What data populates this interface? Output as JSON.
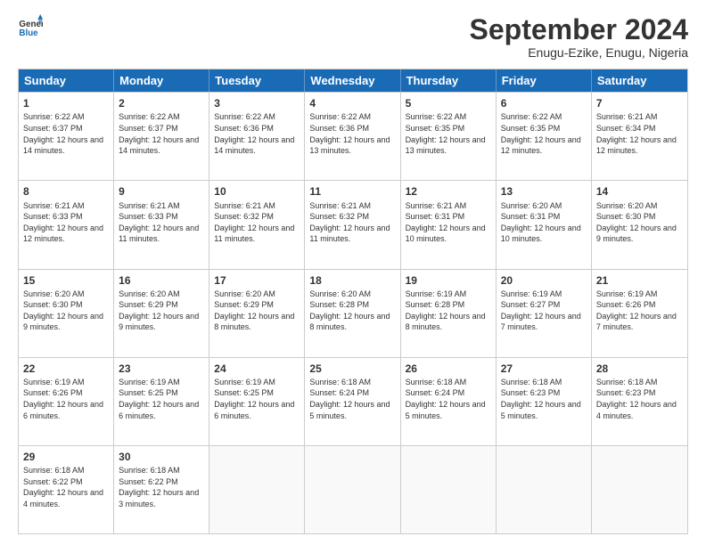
{
  "header": {
    "logo_general": "General",
    "logo_blue": "Blue",
    "month_title": "September 2024",
    "location": "Enugu-Ezike, Enugu, Nigeria"
  },
  "weekdays": [
    "Sunday",
    "Monday",
    "Tuesday",
    "Wednesday",
    "Thursday",
    "Friday",
    "Saturday"
  ],
  "rows": [
    [
      {
        "day": "",
        "empty": true
      },
      {
        "day": "",
        "empty": true
      },
      {
        "day": "",
        "empty": true
      },
      {
        "day": "",
        "empty": true
      },
      {
        "day": "",
        "empty": true
      },
      {
        "day": "",
        "empty": true
      },
      {
        "day": "",
        "empty": true
      }
    ],
    [
      {
        "day": "1",
        "sunrise": "6:22 AM",
        "sunset": "6:37 PM",
        "daylight": "12 hours and 14 minutes."
      },
      {
        "day": "2",
        "sunrise": "6:22 AM",
        "sunset": "6:37 PM",
        "daylight": "12 hours and 14 minutes."
      },
      {
        "day": "3",
        "sunrise": "6:22 AM",
        "sunset": "6:36 PM",
        "daylight": "12 hours and 14 minutes."
      },
      {
        "day": "4",
        "sunrise": "6:22 AM",
        "sunset": "6:36 PM",
        "daylight": "12 hours and 13 minutes."
      },
      {
        "day": "5",
        "sunrise": "6:22 AM",
        "sunset": "6:35 PM",
        "daylight": "12 hours and 13 minutes."
      },
      {
        "day": "6",
        "sunrise": "6:22 AM",
        "sunset": "6:35 PM",
        "daylight": "12 hours and 12 minutes."
      },
      {
        "day": "7",
        "sunrise": "6:21 AM",
        "sunset": "6:34 PM",
        "daylight": "12 hours and 12 minutes."
      }
    ],
    [
      {
        "day": "8",
        "sunrise": "6:21 AM",
        "sunset": "6:33 PM",
        "daylight": "12 hours and 12 minutes."
      },
      {
        "day": "9",
        "sunrise": "6:21 AM",
        "sunset": "6:33 PM",
        "daylight": "12 hours and 11 minutes."
      },
      {
        "day": "10",
        "sunrise": "6:21 AM",
        "sunset": "6:32 PM",
        "daylight": "12 hours and 11 minutes."
      },
      {
        "day": "11",
        "sunrise": "6:21 AM",
        "sunset": "6:32 PM",
        "daylight": "12 hours and 11 minutes."
      },
      {
        "day": "12",
        "sunrise": "6:21 AM",
        "sunset": "6:31 PM",
        "daylight": "12 hours and 10 minutes."
      },
      {
        "day": "13",
        "sunrise": "6:20 AM",
        "sunset": "6:31 PM",
        "daylight": "12 hours and 10 minutes."
      },
      {
        "day": "14",
        "sunrise": "6:20 AM",
        "sunset": "6:30 PM",
        "daylight": "12 hours and 9 minutes."
      }
    ],
    [
      {
        "day": "15",
        "sunrise": "6:20 AM",
        "sunset": "6:30 PM",
        "daylight": "12 hours and 9 minutes."
      },
      {
        "day": "16",
        "sunrise": "6:20 AM",
        "sunset": "6:29 PM",
        "daylight": "12 hours and 9 minutes."
      },
      {
        "day": "17",
        "sunrise": "6:20 AM",
        "sunset": "6:29 PM",
        "daylight": "12 hours and 8 minutes."
      },
      {
        "day": "18",
        "sunrise": "6:20 AM",
        "sunset": "6:28 PM",
        "daylight": "12 hours and 8 minutes."
      },
      {
        "day": "19",
        "sunrise": "6:19 AM",
        "sunset": "6:28 PM",
        "daylight": "12 hours and 8 minutes."
      },
      {
        "day": "20",
        "sunrise": "6:19 AM",
        "sunset": "6:27 PM",
        "daylight": "12 hours and 7 minutes."
      },
      {
        "day": "21",
        "sunrise": "6:19 AM",
        "sunset": "6:26 PM",
        "daylight": "12 hours and 7 minutes."
      }
    ],
    [
      {
        "day": "22",
        "sunrise": "6:19 AM",
        "sunset": "6:26 PM",
        "daylight": "12 hours and 6 minutes."
      },
      {
        "day": "23",
        "sunrise": "6:19 AM",
        "sunset": "6:25 PM",
        "daylight": "12 hours and 6 minutes."
      },
      {
        "day": "24",
        "sunrise": "6:19 AM",
        "sunset": "6:25 PM",
        "daylight": "12 hours and 6 minutes."
      },
      {
        "day": "25",
        "sunrise": "6:18 AM",
        "sunset": "6:24 PM",
        "daylight": "12 hours and 5 minutes."
      },
      {
        "day": "26",
        "sunrise": "6:18 AM",
        "sunset": "6:24 PM",
        "daylight": "12 hours and 5 minutes."
      },
      {
        "day": "27",
        "sunrise": "6:18 AM",
        "sunset": "6:23 PM",
        "daylight": "12 hours and 5 minutes."
      },
      {
        "day": "28",
        "sunrise": "6:18 AM",
        "sunset": "6:23 PM",
        "daylight": "12 hours and 4 minutes."
      }
    ],
    [
      {
        "day": "29",
        "sunrise": "6:18 AM",
        "sunset": "6:22 PM",
        "daylight": "12 hours and 4 minutes."
      },
      {
        "day": "30",
        "sunrise": "6:18 AM",
        "sunset": "6:22 PM",
        "daylight": "12 hours and 3 minutes."
      },
      {
        "day": "",
        "empty": true
      },
      {
        "day": "",
        "empty": true
      },
      {
        "day": "",
        "empty": true
      },
      {
        "day": "",
        "empty": true
      },
      {
        "day": "",
        "empty": true
      }
    ]
  ]
}
